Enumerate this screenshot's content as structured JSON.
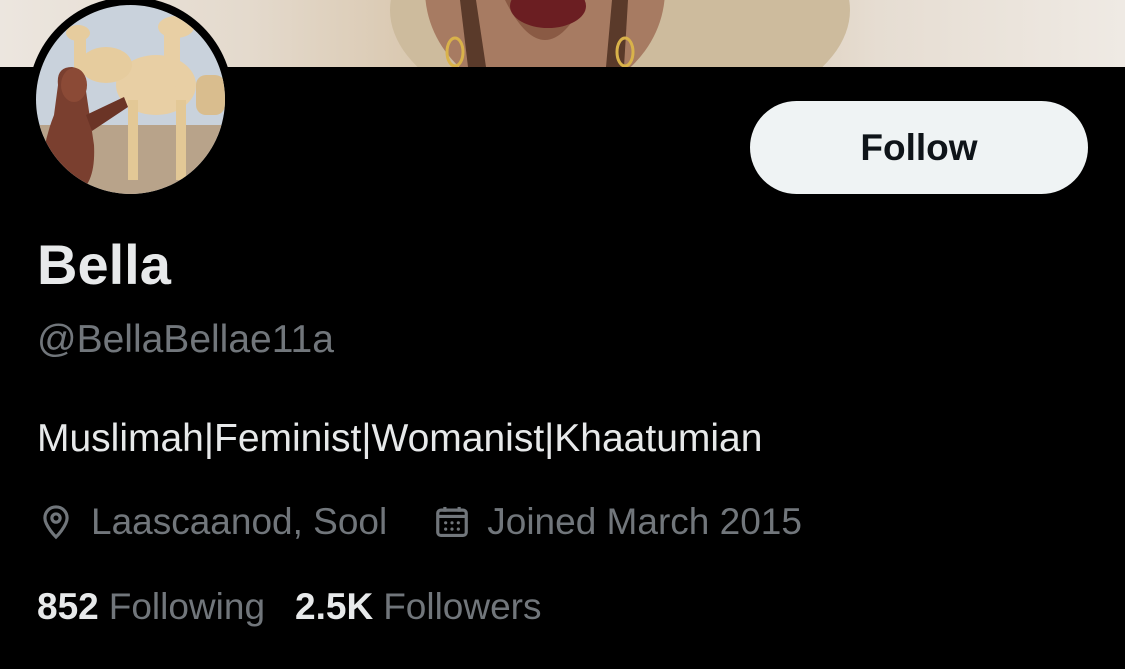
{
  "profile": {
    "name": "Bella",
    "handle": "@BellaBellae11a",
    "bio": "Muslimah|Feminist|Womanist|Khaatumian",
    "location": "Laascaanod, Sool",
    "joined": "Joined March 2015",
    "following_count": "852",
    "following_label": "Following",
    "followers_count": "2.5K",
    "followers_label": "Followers"
  },
  "actions": {
    "follow_label": "Follow"
  },
  "icons": {
    "location": "location-pin-icon",
    "joined": "calendar-icon"
  },
  "colors": {
    "background": "#000000",
    "primary_text": "#e7e9ea",
    "secondary_text": "#71767b",
    "follow_button_bg": "#eff3f4",
    "follow_button_text": "#0f1419"
  }
}
